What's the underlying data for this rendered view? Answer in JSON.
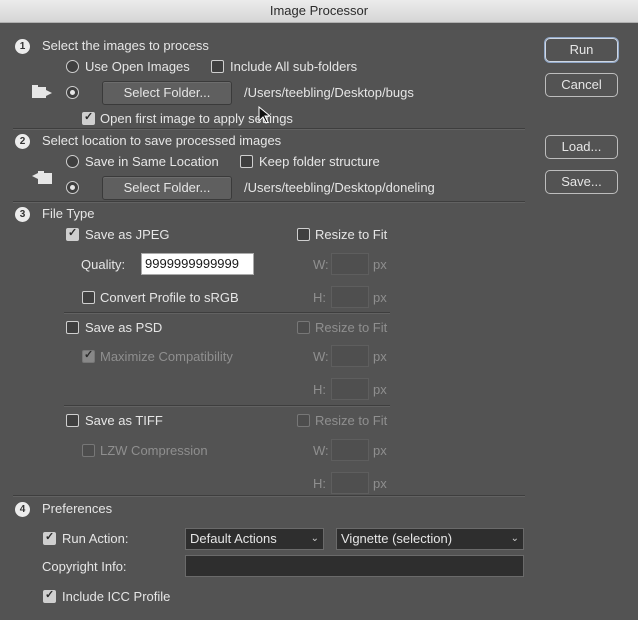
{
  "window": {
    "title": "Image Processor"
  },
  "section1": {
    "number": "1",
    "title": "Select the images to process",
    "use_open_images": "Use Open Images",
    "include_subfolders": "Include All sub-folders",
    "select_folder_button": "Select Folder...",
    "folder_path": "/Users/teebling/Desktop/bugs",
    "open_first_image": "Open first image to apply settings"
  },
  "section2": {
    "number": "2",
    "title": "Select location to save processed images",
    "save_same_location": "Save in Same Location",
    "keep_folder_structure": "Keep folder structure",
    "select_folder_button": "Select Folder...",
    "folder_path": "/Users/teebling/Desktop/doneling"
  },
  "section3": {
    "number": "3",
    "title": "File Type",
    "jpeg": {
      "save_label": "Save as JPEG",
      "checked": true,
      "resize_label": "Resize to Fit",
      "quality_label": "Quality:",
      "quality_value": "9999999999999",
      "convert_profile": "Convert Profile to sRGB",
      "w_label": "W:",
      "h_label": "H:",
      "unit": "px"
    },
    "psd": {
      "save_label": "Save as PSD",
      "resize_label": "Resize to Fit",
      "maximize": "Maximize Compatibility",
      "w_label": "W:",
      "h_label": "H:",
      "unit": "px"
    },
    "tiff": {
      "save_label": "Save as TIFF",
      "resize_label": "Resize to Fit",
      "lzw": "LZW Compression",
      "w_label": "W:",
      "h_label": "H:",
      "unit": "px"
    }
  },
  "section4": {
    "number": "4",
    "title": "Preferences",
    "run_action_label": "Run Action:",
    "action_set": "Default Actions",
    "action": "Vignette (selection)",
    "copyright_label": "Copyright Info:",
    "copyright_value": "",
    "include_icc": "Include ICC Profile"
  },
  "buttons": {
    "run": "Run",
    "cancel": "Cancel",
    "load": "Load...",
    "save": "Save..."
  }
}
